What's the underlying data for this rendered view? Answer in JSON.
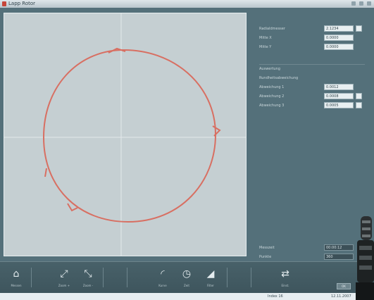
{
  "window": {
    "title": "Lapp Rotor"
  },
  "readouts": {
    "rows": [
      {
        "label": "Radialdmesser",
        "value": "2.1234"
      },
      {
        "label": "Mitte X",
        "value": "0.0000"
      },
      {
        "label": "Mitte Y",
        "value": "0.0000"
      }
    ],
    "section_title": "Auswertung",
    "subsection_title": "Rundheitsabweichung",
    "fit_rows": [
      {
        "label": "Abweichung 1",
        "value": "0.0012"
      },
      {
        "label": "Abweichung 2",
        "value": "0.0008"
      },
      {
        "label": "Abweichung 3",
        "value": "0.0005"
      }
    ],
    "bottom_rows": [
      {
        "label": "Messzeit",
        "value": "00:00:12"
      },
      {
        "label": "Punkte",
        "value": "360"
      }
    ]
  },
  "plot": {
    "circle_color": "#d86f62",
    "background": "#c5cfd2",
    "crosshair_color": "#e3e9eb"
  },
  "toolbar": {
    "buttons": [
      {
        "name": "measure-icon",
        "label": "Messen",
        "glyph": "⌂"
      },
      {
        "name": "zoom-in-icon",
        "label": "Zoom +",
        "glyph": "⤢"
      },
      {
        "name": "zoom-out-icon",
        "label": "Zoom -",
        "glyph": "⤡"
      },
      {
        "name": "chart-icon",
        "label": "Kurve",
        "glyph": "◜"
      },
      {
        "name": "clock-icon",
        "label": "Zeit",
        "glyph": "◷"
      },
      {
        "name": "wedge-icon",
        "label": "Filter",
        "glyph": "◢"
      },
      {
        "name": "settings-icon",
        "label": "Einst.",
        "glyph": "⇄"
      }
    ],
    "right_button": "OK"
  },
  "status": {
    "left": "Index 16",
    "right": "12.11.2007"
  }
}
